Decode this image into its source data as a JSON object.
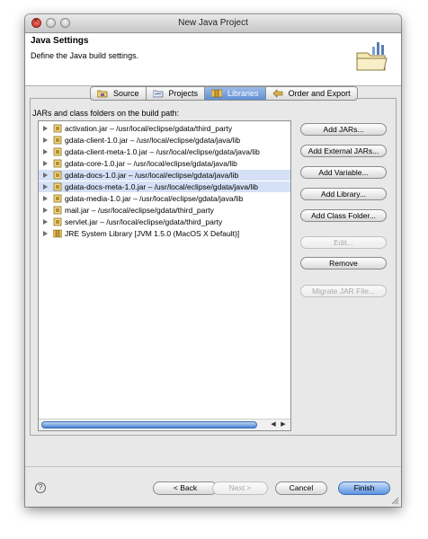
{
  "window": {
    "title": "New Java Project"
  },
  "header": {
    "title": "Java Settings",
    "description": "Define the Java build settings."
  },
  "tabs": [
    {
      "label": "Source",
      "icon": "source-folder-icon",
      "active": false
    },
    {
      "label": "Projects",
      "icon": "projects-icon",
      "active": false
    },
    {
      "label": "Libraries",
      "icon": "libraries-icon",
      "active": true
    },
    {
      "label": "Order and Export",
      "icon": "order-export-icon",
      "active": false
    }
  ],
  "buildpath": {
    "label": "JARs and class folders on the build path:",
    "items": [
      {
        "text": "activation.jar – /usr/local/eclipse/gdata/third_party",
        "selected": false
      },
      {
        "text": "gdata-client-1.0.jar – /usr/local/eclipse/gdata/java/lib",
        "selected": false
      },
      {
        "text": "gdata-client-meta-1.0.jar – /usr/local/eclipse/gdata/java/lib",
        "selected": false
      },
      {
        "text": "gdata-core-1.0.jar – /usr/local/eclipse/gdata/java/lib",
        "selected": false
      },
      {
        "text": "gdata-docs-1.0.jar – /usr/local/eclipse/gdata/java/lib",
        "selected": true
      },
      {
        "text": "gdata-docs-meta-1.0.jar – /usr/local/eclipse/gdata/java/lib",
        "selected": true
      },
      {
        "text": "gdata-media-1.0.jar – /usr/local/eclipse/gdata/java/lib",
        "selected": false
      },
      {
        "text": "mail.jar – /usr/local/eclipse/gdata/third_party",
        "selected": false
      },
      {
        "text": "servlet.jar – /usr/local/eclipse/gdata/third_party",
        "selected": false
      },
      {
        "text": "JRE System Library [JVM 1.5.0 (MacOS X Default)]",
        "selected": false
      }
    ]
  },
  "side_buttons": {
    "add_jars": "Add JARs...",
    "add_external_jars": "Add External JARs...",
    "add_variable": "Add Variable...",
    "add_library": "Add Library...",
    "add_class_folder": "Add Class Folder...",
    "edit": "Edit...",
    "remove": "Remove",
    "migrate_jar": "Migrate JAR File..."
  },
  "footer": {
    "help": "?",
    "back": "< Back",
    "next": "Next >",
    "cancel": "Cancel",
    "finish": "Finish"
  },
  "colors": {
    "selection": "#d5e1f6",
    "accent": "#5b93df"
  }
}
